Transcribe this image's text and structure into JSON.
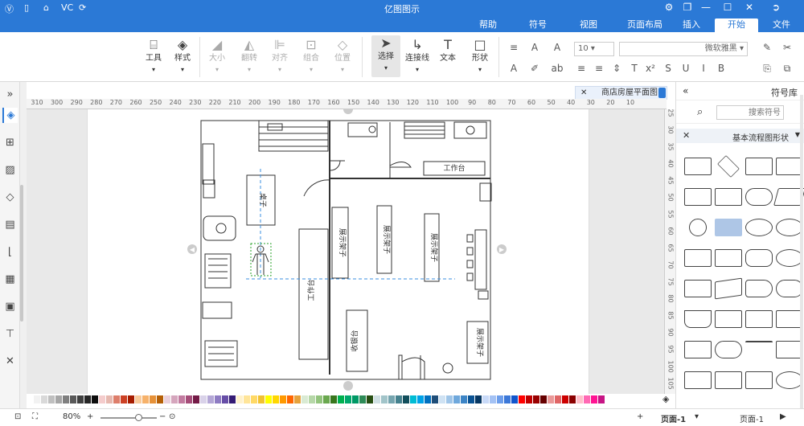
{
  "app": {
    "title": "亿图图示"
  },
  "titlebar": {
    "quick_icons": [
      "Ⓥ",
      "▯",
      "VC",
      "Ⓜ",
      "⟳"
    ]
  },
  "tabs": [
    {
      "label": "文件",
      "active": false
    },
    {
      "label": "开始",
      "active": true
    },
    {
      "label": "插入",
      "active": false
    },
    {
      "label": "页面布局",
      "active": false
    },
    {
      "label": "视图",
      "active": false
    },
    {
      "label": "符号",
      "active": false
    },
    {
      "label": "帮助",
      "active": false
    }
  ],
  "ribbon": {
    "tools": "工具",
    "style": "样式",
    "size": "大小",
    "rotate": "翻转",
    "align": "对齐",
    "group": "组合",
    "position": "位置",
    "select": "选择",
    "connector": "连接线",
    "text": "文本",
    "shape": "形状",
    "font_name": "微软雅黑",
    "font_size": "10"
  },
  "document": {
    "tab_title": "商店房屋平面图"
  },
  "ruler_h": [
    "310",
    "300",
    "290",
    "280",
    "270",
    "260",
    "250",
    "240",
    "230",
    "220",
    "210",
    "200",
    "190",
    "180",
    "170",
    "160",
    "150",
    "140",
    "130",
    "120",
    "110",
    "100",
    "90",
    "80",
    "70",
    "60",
    "50",
    "40",
    "30",
    "20",
    "10"
  ],
  "ruler_v": [
    "25",
    "30",
    "35",
    "40",
    "45",
    "50",
    "55",
    "60",
    "65",
    "70",
    "75",
    "80",
    "85",
    "90",
    "95",
    "100",
    "105"
  ],
  "floorplan": {
    "labels": {
      "workbench_top": "工作台",
      "workbench_center": "工作台",
      "shelf1": "展示架子",
      "shelf2": "展示架子",
      "shelf3": "展示架子",
      "shelf4": "展示架子",
      "cashier": "收银台",
      "table_left": "桌子"
    }
  },
  "library": {
    "title": "符号库",
    "search_placeholder": "搜索符号",
    "category": "基本流程图形状"
  },
  "status": {
    "page_name": "页面-1",
    "page_tab": "页面-1",
    "add": "+",
    "zoom": "80%"
  },
  "colors": {
    "accent": "#2b79d6",
    "palette": [
      "#ffffff",
      "#f2f2f2",
      "#d9d9d9",
      "#bfbfbf",
      "#a6a6a6",
      "#808080",
      "#595959",
      "#404040",
      "#262626",
      "#0d0d0d",
      "#f4cccc",
      "#e6b8af",
      "#dd7e6b",
      "#cc4125",
      "#a61c00",
      "#f9cb9c",
      "#f6b26b",
      "#e69138",
      "#b45f06",
      "#ead1dc",
      "#d5a6bd",
      "#c27ba0",
      "#a64d79",
      "#741b47",
      "#d9d2e9",
      "#b4a7d6",
      "#8e7cc3",
      "#674ea7",
      "#351c75",
      "#fff2cc",
      "#ffe599",
      "#ffd966",
      "#f1c232",
      "#ffff00",
      "#ffd700",
      "#ff9900",
      "#ff6600",
      "#e6a23c",
      "#d9ead3",
      "#b6d7a8",
      "#93c47d",
      "#6aa84f",
      "#38761d",
      "#00b050",
      "#00a86b",
      "#009966",
      "#2e8b57",
      "#274e13",
      "#d0e0e3",
      "#a2c4c9",
      "#76a5af",
      "#45818e",
      "#134f5c",
      "#00bcd4",
      "#00a2e8",
      "#0070c0",
      "#1f4e79",
      "#cfe2f3",
      "#9fc5e8",
      "#6fa8dc",
      "#3d85c6",
      "#0b5394",
      "#073763",
      "#c9daf8",
      "#a4c2f4",
      "#6d9eeb",
      "#3c78d8",
      "#1155cc",
      "#ff0000",
      "#c00000",
      "#990000",
      "#660000",
      "#ea9999",
      "#e06666",
      "#cc0000",
      "#8b0000",
      "#ffc0cb",
      "#ff69b4",
      "#ff1493",
      "#c71585"
    ]
  }
}
